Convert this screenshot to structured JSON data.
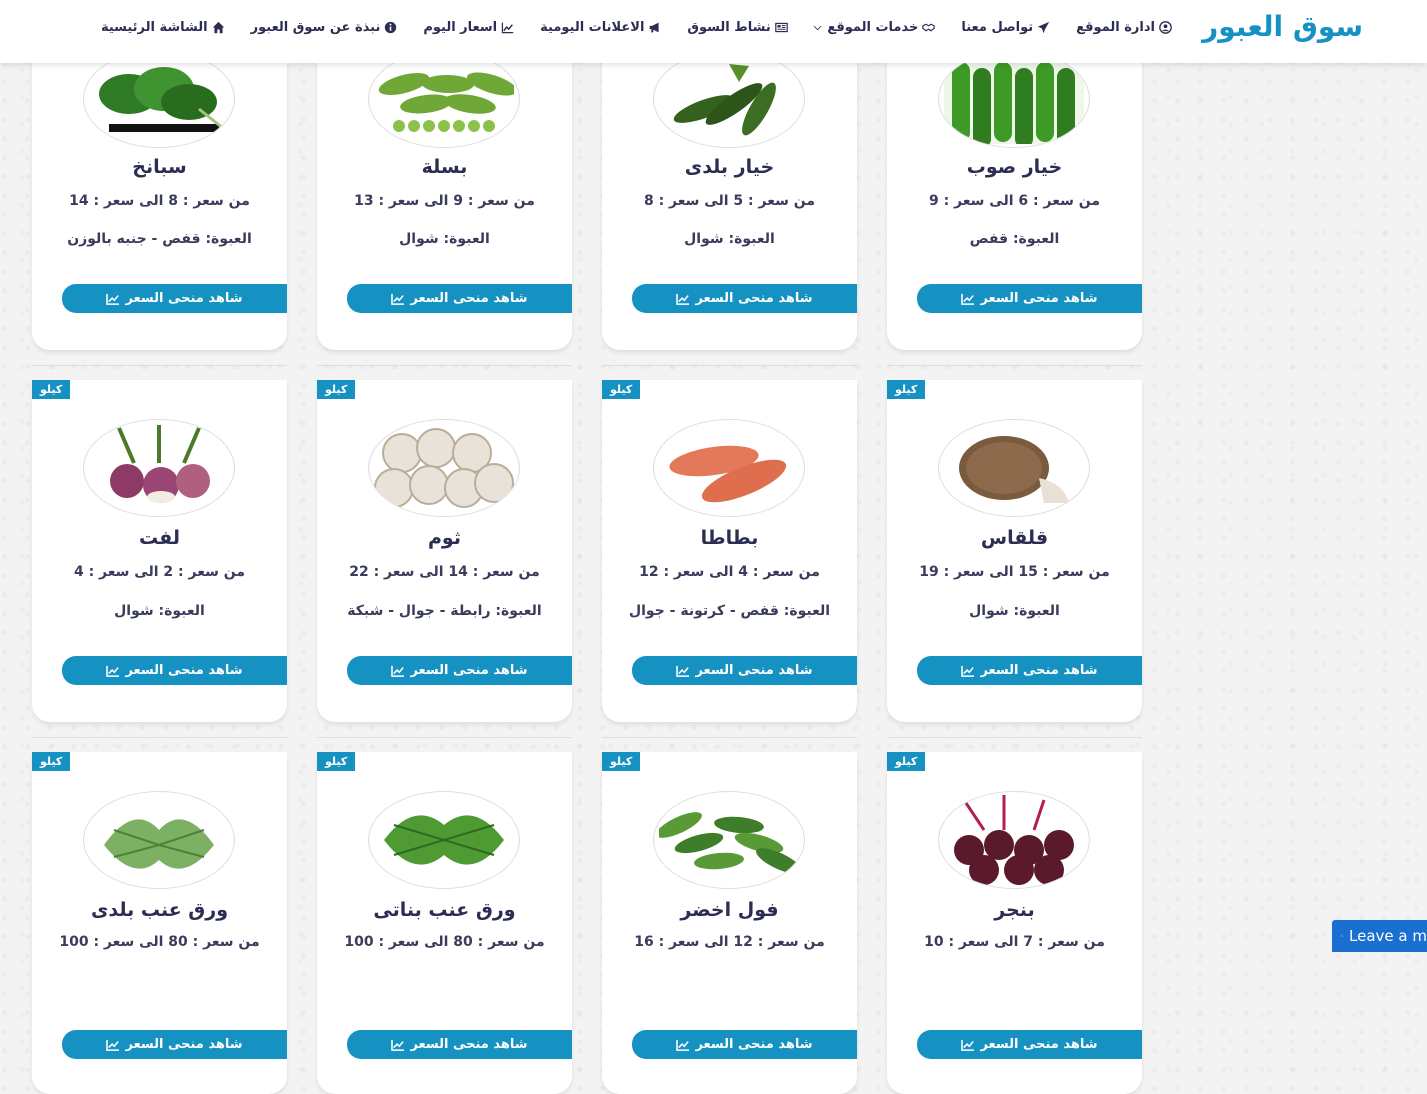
{
  "brand": "سوق العبور",
  "nav": [
    {
      "label": "الشاشة الرئيسية",
      "icon": "home-icon"
    },
    {
      "label": "نبذة عن سوق العبور",
      "icon": "info-icon"
    },
    {
      "label": "اسعار اليوم",
      "icon": "chart-icon"
    },
    {
      "label": "الاعلانات اليومية",
      "icon": "megaphone-icon"
    },
    {
      "label": "نشاط السوق",
      "icon": "newspaper-icon"
    },
    {
      "label": "خدمات الموقع",
      "icon": "handshake-icon"
    },
    {
      "label": "تواصل معنا",
      "icon": "paper-plane-icon"
    },
    {
      "label": "ادارة الموقع",
      "icon": "user-circle-icon"
    }
  ],
  "button_label": "شاهد منحى السعر",
  "unit_badge": "كيلو",
  "products": [
    {
      "name": "خيار صوب",
      "price": "من سعر : 6 الى سعر : 9",
      "pack": "العبوة: قفص",
      "image": "cucumber-greenhouse-image"
    },
    {
      "name": "خيار بلدى",
      "price": "من سعر : 5 الى سعر : 8",
      "pack": "العبوة: شوال",
      "image": "cucumber-local-image"
    },
    {
      "name": "بسلة",
      "price": "من سعر : 9 الى سعر : 13",
      "pack": "العبوة: شوال",
      "image": "peas-image"
    },
    {
      "name": "سبانخ",
      "price": "من سعر : 8 الى سعر : 14",
      "pack": "العبوة: قفص - جنبه بالوزن",
      "image": "spinach-image"
    },
    {
      "name": "قلقاس",
      "price": "من سعر : 15 الى سعر : 19",
      "pack": "العبوة: شوال",
      "image": "taro-image"
    },
    {
      "name": "بطاطا",
      "price": "من سعر : 4 الى سعر : 12",
      "pack": "العبوة: قفص - كرتونة - جوال",
      "image": "sweet-potato-image"
    },
    {
      "name": "ثوم",
      "price": "من سعر : 14 الى سعر : 22",
      "pack": "العبوة: رابطة - جوال - شبكة",
      "image": "garlic-image"
    },
    {
      "name": "لفت",
      "price": "من سعر : 2 الى سعر : 4",
      "pack": "العبوة: شوال",
      "image": "turnip-image"
    },
    {
      "name": "بنجر",
      "price": "من سعر : 7 الى سعر : 10",
      "pack": "",
      "image": "beetroot-image"
    },
    {
      "name": "فول اخضر",
      "price": "من سعر : 12 الى سعر : 16",
      "pack": "",
      "image": "green-beans-image"
    },
    {
      "name": "ورق عنب بناتى",
      "price": "من سعر : 80 الى سعر : 100",
      "pack": "",
      "image": "vine-leaves-image"
    },
    {
      "name": "ورق عنب بلدى",
      "price": "من سعر : 80 الى سعر : 100",
      "pack": "",
      "image": "vine-leaves-local-image"
    }
  ],
  "leave_message": "Leave a m"
}
